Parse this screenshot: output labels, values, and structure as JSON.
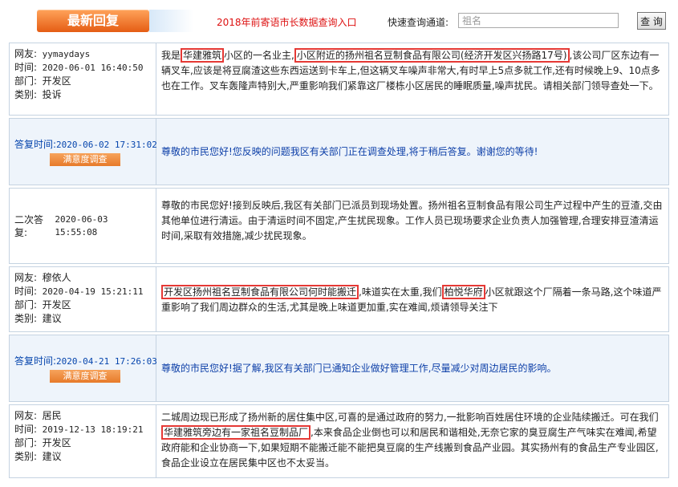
{
  "header": {
    "tab_label": "最新回复",
    "title_link": "2018年前寄语市长数据查询入口",
    "quick_search_label": "快速查询通道:",
    "search_placeholder": "祖名",
    "search_button": "查 询"
  },
  "labels": {
    "user": "网友:",
    "time": "时间:",
    "dept": "部门:",
    "type": "类别:",
    "reply_time": "答复时间:",
    "second_reply": "二次答复:",
    "survey": "满意度调查"
  },
  "posts": [
    {
      "user": "yymaydays",
      "time": "2020-06-01 16:40:50",
      "dept": "开发区",
      "type": "投诉",
      "content": {
        "p1": "我是",
        "h1": "华建雅筑",
        "p2": "小区的一名业主,",
        "h2": "小区附近的扬州祖名豆制食品有限公司(经济开发区兴扬路17号)",
        "p3": ",该公司厂区东边有一辆叉车,应该是将豆腐渣这些东西运送到卡车上,但这辆叉车噪声非常大,有时早上5点多就工作,还有时候晚上9、10点多也在工作。叉车轰隆声特别大,严重影响我们紧靠这厂楼栋小区居民的睡眠质量,噪声扰民。请相关部门领导查处一下。"
      },
      "reply_time": "2020-06-02 17:31:02",
      "reply_content": "尊敬的市民您好!您反映的问题我区有关部门正在调查处理,将于稍后答复。谢谢您的等待!",
      "second_reply_time": "2020-06-03 15:55:08",
      "second_reply_content": "尊敬的市民您好!接到反映后,我区有关部门已派员到现场处置。扬州祖名豆制食品有限公司生产过程中产生的豆渣,交由其他单位进行清运。由于清运时间不固定,产生扰民现象。工作人员已现场要求企业负责人加强管理,合理安排豆渣清运时间,采取有效措施,减少扰民现象。"
    },
    {
      "user": "穆依人",
      "time": "2020-04-19 15:21:11",
      "dept": "开发区",
      "type": "建议",
      "content": {
        "h1": "开发区扬州祖名豆制食品有限公司何时能搬迁",
        "p1": ",味道实在太重,我们",
        "h2": "柏悦华府",
        "p2": "小区就跟这个厂隔着一条马路,这个味道严重影响了我们周边群众的生活,尤其是晚上味道更加重,实在难闻,烦请领导关注下"
      },
      "reply_time": "2020-04-21 17:26:03",
      "reply_content": "尊敬的市民您好!据了解,我区有关部门已通知企业做好管理工作,尽量减少对周边居民的影响。"
    },
    {
      "user": "居民",
      "time": "2019-12-13 18:19:21",
      "dept": "开发区",
      "type": "建议",
      "content": {
        "p1": "二城周边现已形成了扬州新的居住集中区,可喜的是通过政府的努力,一批影响百姓居住环境的企业陆续搬迁。可在我们",
        "h1": "华建雅筑旁边有一家祖名豆制品厂",
        "p2": ",本来食品企业倒也可以和居民和谐相处,无奈它家的臭豆腐生产气味实在难闻,希望政府能和企业协商一下,如果短期不能搬迁能不能把臭豆腐的生产线搬到食品产业园。其实扬州有的食品生产专业园区,食品企业设立在居民集中区也不太妥当。"
      }
    }
  ],
  "colors": {
    "accent_orange": "#e55d14",
    "reply_blue": "#0d3fa8",
    "highlight_red": "#e53935",
    "link_red": "#dd1111"
  }
}
